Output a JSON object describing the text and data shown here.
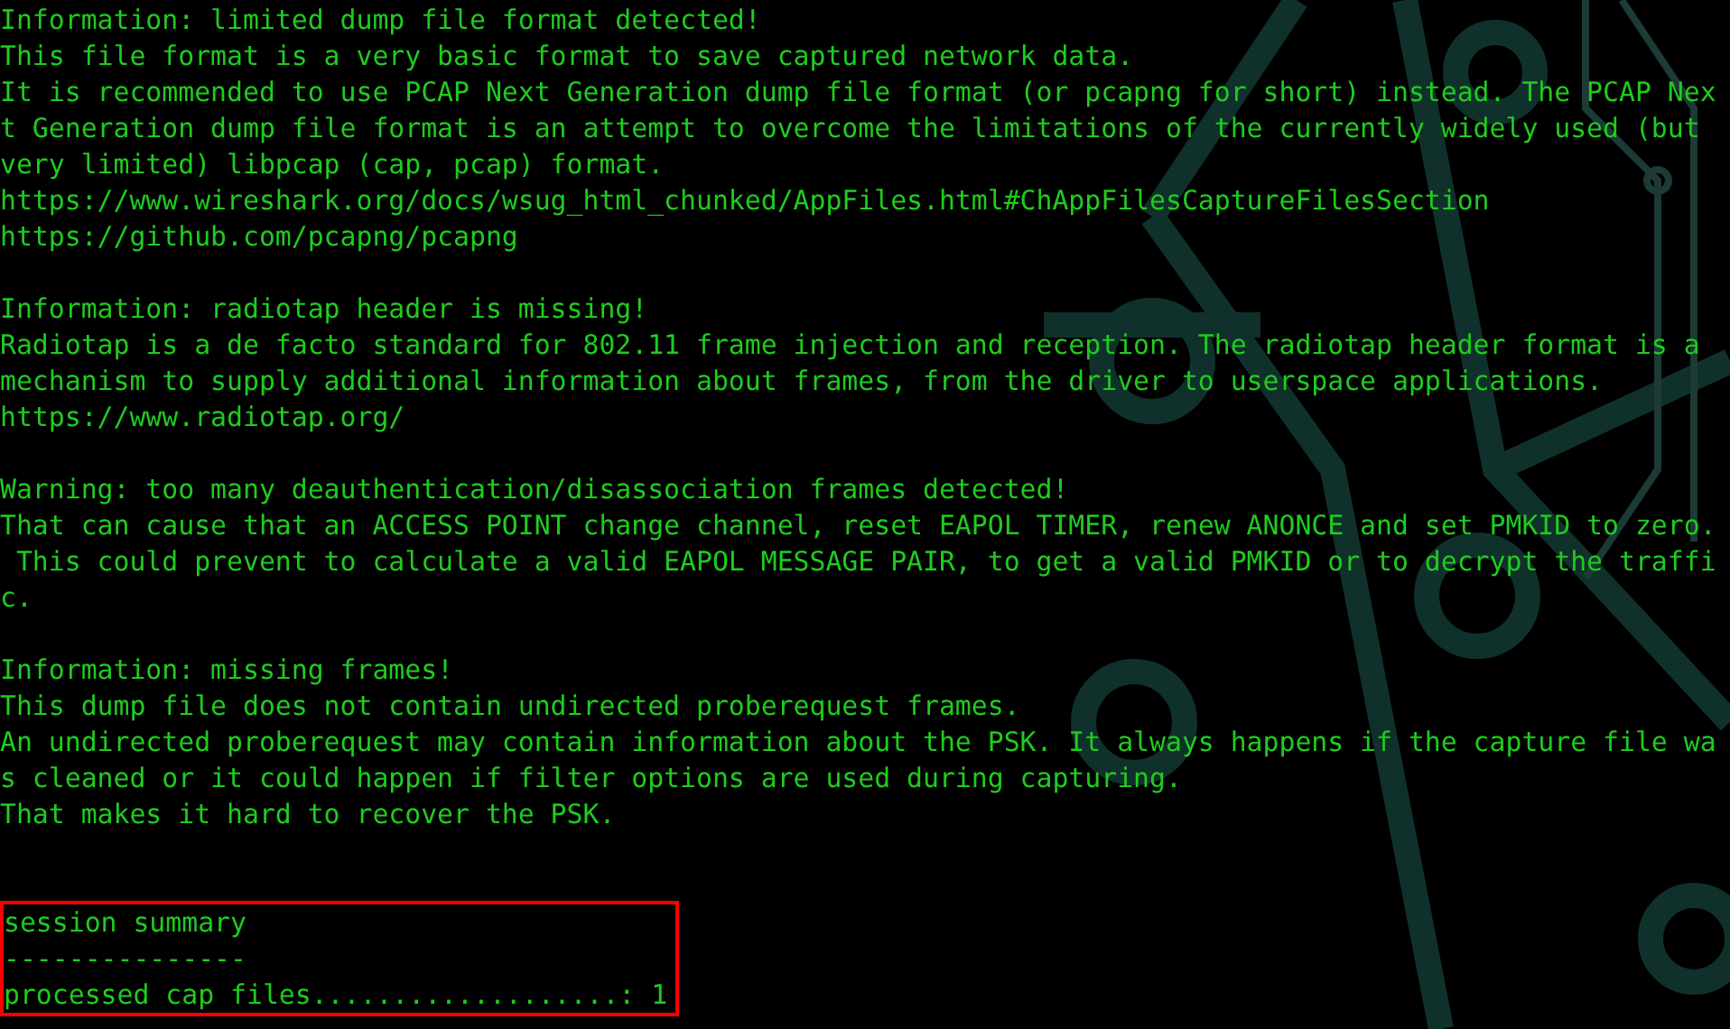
{
  "terminal": {
    "blocks": [
      {
        "highlighted": false,
        "lines": [
          "Information: limited dump file format detected!",
          "This file format is a very basic format to save captured network data.",
          "It is recommended to use PCAP Next Generation dump file format (or pcapng for short) instead. The PCAP Nex",
          "t Generation dump file format is an attempt to overcome the limitations of the currently widely used (but",
          "very limited) libpcap (cap, pcap) format.",
          "https://www.wireshark.org/docs/wsug_html_chunked/AppFiles.html#ChAppFilesCaptureFilesSection",
          "https://github.com/pcapng/pcapng"
        ]
      },
      {
        "highlighted": false,
        "lines": [
          "Information: radiotap header is missing!",
          "Radiotap is a de facto standard for 802.11 frame injection and reception. The radiotap header format is a",
          "mechanism to supply additional information about frames, from the driver to userspace applications.",
          "https://www.radiotap.org/"
        ]
      },
      {
        "highlighted": false,
        "lines": [
          "Warning: too many deauthentication/disassociation frames detected!",
          "That can cause that an ACCESS POINT change channel, reset EAPOL TIMER, renew ANONCE and set PMKID to zero.",
          " This could prevent to calculate a valid EAPOL MESSAGE PAIR, to get a valid PMKID or to decrypt the traffi",
          "c."
        ]
      },
      {
        "highlighted": false,
        "lines": [
          "Information: missing frames!",
          "This dump file does not contain undirected proberequest frames.",
          "An undirected proberequest may contain information about the PSK. It always happens if the capture file wa",
          "s cleaned or it could happen if filter options are used during capturing.",
          "That makes it hard to recover the PSK."
        ]
      },
      {
        "highlighted": true,
        "lines": [
          "session summary",
          "---------------",
          "processed cap files...................: 1"
        ]
      }
    ]
  }
}
